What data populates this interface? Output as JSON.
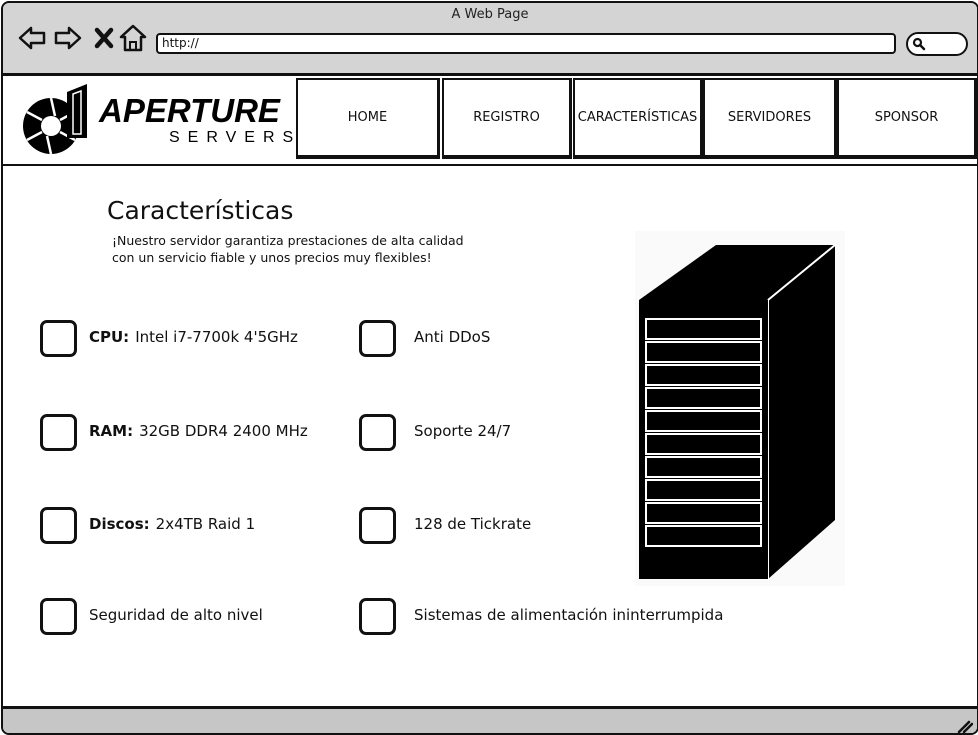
{
  "window": {
    "title": "A Web Page"
  },
  "browser": {
    "url": "http://"
  },
  "logo": {
    "word": "APERTURE",
    "sub": "SERVERS"
  },
  "nav": [
    {
      "label": "HOME"
    },
    {
      "label": "REGISTRO"
    },
    {
      "label": "CARACTERÍSTICAS"
    },
    {
      "label": "SERVIDORES"
    },
    {
      "label": "SPONSOR"
    }
  ],
  "page": {
    "title": "Características",
    "intro_line1": "¡Nuestro servidor garantiza prestaciones de alta calidad",
    "intro_line2": "con un servicio fiable y unos precios muy flexibles!"
  },
  "features_left": [
    {
      "key": "CPU:",
      "value": "Intel i7-7700k 4'5GHz"
    },
    {
      "key": "RAM:",
      "value": "32GB DDR4 2400 MHz"
    },
    {
      "key": "Discos:",
      "value": "2x4TB Raid 1"
    },
    {
      "key": "",
      "value": "Seguridad de alto nivel"
    }
  ],
  "features_right": [
    {
      "value": "Anti DDoS"
    },
    {
      "value": "Soporte 24/7"
    },
    {
      "value": "128 de Tickrate"
    },
    {
      "value": "Sistemas de alimentación ininterrumpida"
    }
  ]
}
